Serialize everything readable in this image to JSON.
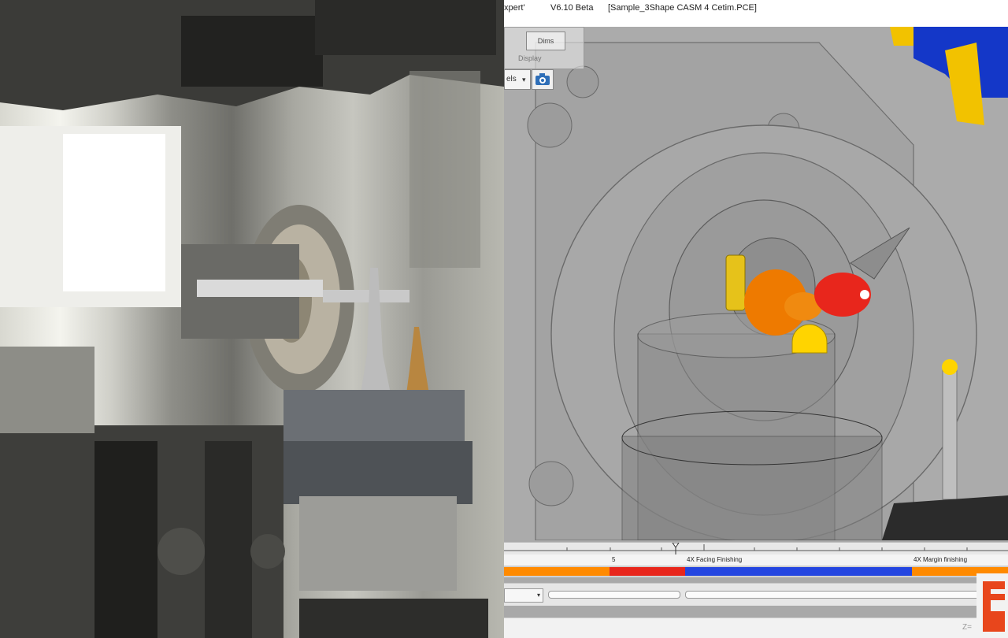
{
  "window": {
    "title_prefix": "xpert'",
    "version": "V6.10 Beta",
    "filename": "[Sample_3Shape CASM 4 Cetim.PCE]"
  },
  "overlay": {
    "tab_label": "Dims",
    "sub_label": "Display"
  },
  "display_select": {
    "value": "els"
  },
  "timeline": {
    "operations": [
      {
        "label": "5",
        "color": "#ff8a00",
        "status_color": "#e8261c"
      },
      {
        "label": "4X Facing Finishing",
        "color": "#2446e0"
      },
      {
        "label": "4X Margin finishing",
        "color": "#ff8a00"
      }
    ]
  },
  "status": {
    "zoom_label": "Z="
  },
  "colors": {
    "viewport_bg": "#a9a9a9",
    "tool_red": "#e8261c",
    "tool_orange": "#ee7a00",
    "tool_yellow": "#ffd400",
    "spindle_blue": "#1437c8",
    "spindle_yellow": "#f2c200",
    "brand_red": "#e8461c"
  },
  "icons": {
    "camera": "camera-icon",
    "dropdown": "chevron-down-icon"
  }
}
